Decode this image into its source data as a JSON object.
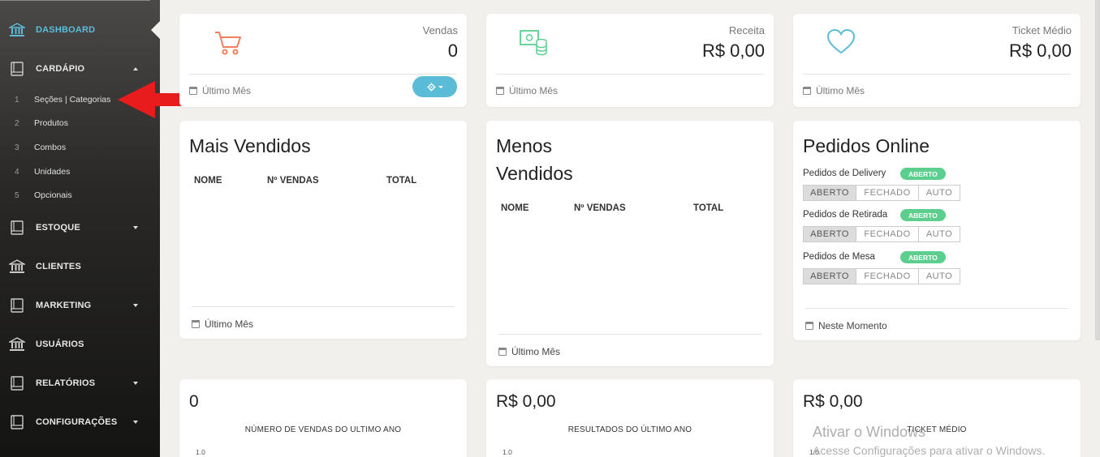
{
  "sidebar": {
    "items": [
      {
        "label": "DASHBOARD",
        "icon": "bank-icon"
      },
      {
        "label": "CARDÁPIO",
        "icon": "book-icon"
      },
      {
        "label": "ESTOQUE",
        "icon": "book-icon"
      },
      {
        "label": "CLIENTES",
        "icon": "bank-icon"
      },
      {
        "label": "MARKETING",
        "icon": "book-icon"
      },
      {
        "label": "USUÁRIOS",
        "icon": "bank-icon"
      },
      {
        "label": "RELATÓRIOS",
        "icon": "book-icon"
      },
      {
        "label": "CONFIGURAÇÕES",
        "icon": "book-icon"
      }
    ],
    "submenu": [
      {
        "num": "1",
        "label": "Seções | Categorias"
      },
      {
        "num": "2",
        "label": "Produtos"
      },
      {
        "num": "3",
        "label": "Combos"
      },
      {
        "num": "4",
        "label": "Unidades"
      },
      {
        "num": "5",
        "label": "Opcionais"
      }
    ]
  },
  "stats": [
    {
      "label": "Vendas",
      "value": "0",
      "footer": "Último Mês",
      "icon": "cart-icon",
      "color": "#f08060"
    },
    {
      "label": "Receita",
      "value": "R$ 0,00",
      "footer": "Último Mês",
      "icon": "money-icon",
      "color": "#5ccf8f"
    },
    {
      "label": "Ticket Médio",
      "value": "R$ 0,00",
      "footer": "Último Mês",
      "icon": "heart-icon",
      "color": "#5bbcd8"
    }
  ],
  "mais_vendidos": {
    "title": "Mais Vendidos",
    "columns": [
      "NOME",
      "Nº VENDAS",
      "TOTAL"
    ],
    "footer": "Último Mês"
  },
  "menos_vendidos": {
    "title_line1": "Menos",
    "title_line2": "Vendidos",
    "columns": [
      "NOME",
      "Nº VENDAS",
      "TOTAL"
    ],
    "footer": "Último Mês"
  },
  "pedidos_online": {
    "title": "Pedidos Online",
    "rows": [
      {
        "label": "Pedidos de Delivery",
        "badge": "ABERTO"
      },
      {
        "label": "Pedidos de Retirada",
        "badge": "ABERTO"
      },
      {
        "label": "Pedidos de Mesa",
        "badge": "ABERTO"
      }
    ],
    "options": [
      "ABERTO",
      "FECHADO",
      "AUTO"
    ],
    "footer": "Neste Momento"
  },
  "charts": [
    {
      "value": "0",
      "title": "NÚMERO DE VENDAS DO ULTIMO ANO",
      "ytick": "1.0"
    },
    {
      "value": "R$ 0,00",
      "title": "RESULTADOS DO ÚLTIMO ANO",
      "ytick": "1.0"
    },
    {
      "value": "R$ 0,00",
      "title": "TICKET MÉDIO",
      "ytick": "1.0"
    }
  ],
  "watermark": {
    "line1": "Ativar o Windows",
    "line2": "Acesse Configurações para ativar o Windows."
  },
  "colors": {
    "accent": "#5bbcd8",
    "badge": "#5ccf8f",
    "arrow": "#e81c1c"
  }
}
